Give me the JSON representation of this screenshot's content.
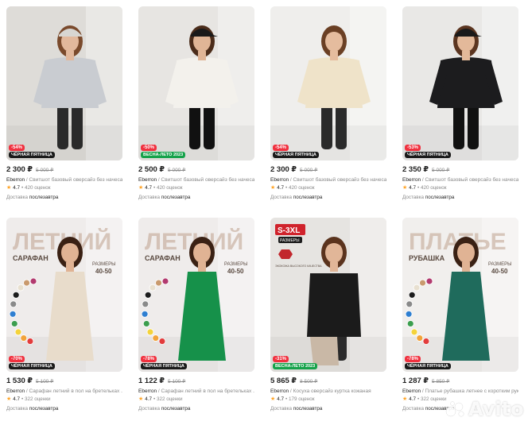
{
  "listing": {
    "products": [
      {
        "price": "2 300 ₽",
        "old_price": "5 000 ₽",
        "brand": "Eberron",
        "title": " / Свитшот базовый оверсайз без начеса ...",
        "rating": "4.7",
        "reviews": "• 420 оценок",
        "delivery_prefix": "Доставка ",
        "delivery_day": "послезавтра",
        "discount": "-54%",
        "promo": "ЧЁРНАЯ ПЯТНИЦА",
        "promo_color": "#1a1a1a",
        "photo_bg": "#dedcd8",
        "garment": "#c9ccd1",
        "skin": "#e2b89c",
        "hair": "#7a4a2c"
      },
      {
        "price": "2 500 ₽",
        "old_price": "5 000 ₽",
        "brand": "Eberron",
        "title": " / Свитшот базовый оверсайз без начеса ...",
        "rating": "4.7",
        "reviews": "• 420 оценок",
        "delivery_prefix": "Доставка ",
        "delivery_day": "послезавтра",
        "discount": "-50%",
        "promo": "ВЕСНА-ЛЕТО 2023",
        "promo_color": "#15a24a",
        "photo_bg": "#e7e5e2",
        "garment": "#f3f1ec",
        "skin": "#e0b596",
        "hair": "#4b2c1a"
      },
      {
        "price": "2 300 ₽",
        "old_price": "5 000 ₽",
        "brand": "Eberron",
        "title": " / Свитшот базовый оверсайз без начеса ...",
        "rating": "4.7",
        "reviews": "• 420 оценок",
        "delivery_prefix": "Доставка ",
        "delivery_day": "послезавтра",
        "discount": "-54%",
        "promo": "ЧЁРНАЯ ПЯТНИЦА",
        "promo_color": "#1a1a1a",
        "photo_bg": "#efeeec",
        "garment": "#efe3c9",
        "skin": "#e5bc9e",
        "hair": "#6a3f24"
      },
      {
        "price": "2 350 ₽",
        "old_price": "5 000 ₽",
        "brand": "Eberron",
        "title": " / Свитшот базовый оверсайз без начеса ...",
        "rating": "4.7",
        "reviews": "• 420 оценок",
        "delivery_prefix": "Доставка ",
        "delivery_day": "послезавтра",
        "discount": "-53%",
        "promo": "ЧЁРНАЯ ПЯТНИЦА",
        "promo_color": "#1a1a1a",
        "photo_bg": "#e9e8e6",
        "garment": "#1c1c1e",
        "skin": "#e3b99a",
        "hair": "#5b3520"
      },
      {
        "price": "1 530 ₽",
        "old_price": "5 100 ₽",
        "brand": "Eberron",
        "title": " / Сарафан летний в пол на бретельках ...",
        "rating": "4.7",
        "reviews": "• 322 оценки",
        "delivery_prefix": "Доставка ",
        "delivery_day": "послезавтра",
        "discount": "-70%",
        "promo": "ЧЁРНАЯ ПЯТНИЦА",
        "promo_color": "#1a1a1a",
        "photo_bg": "#efeceb",
        "garment": "#e8dccb",
        "skin": "#e0b394",
        "hair": "#3a2114",
        "banner": {
          "headline": "ЛЕТНИЙ",
          "sub": "САРАФАН",
          "sizes_label": "РАЗМЕРЫ",
          "sizes": "40-50"
        }
      },
      {
        "price": "1 122 ₽",
        "old_price": "5 100 ₽",
        "brand": "Eberron",
        "title": " / Сарафан летний в пол на бретельках ...",
        "rating": "4.7",
        "reviews": "• 322 оценки",
        "delivery_prefix": "Доставка ",
        "delivery_day": "послезавтра",
        "discount": "-78%",
        "promo": "ЧЁРНАЯ ПЯТНИЦА",
        "promo_color": "#1a1a1a",
        "photo_bg": "#efeceb",
        "garment": "#16914a",
        "skin": "#e0b394",
        "hair": "#3a2114",
        "banner": {
          "headline": "ЛЕТНИЙ",
          "sub": "САРАФАН",
          "sizes_label": "РАЗМЕРЫ",
          "sizes": "40-50"
        }
      },
      {
        "price": "5 865 ₽",
        "old_price": "8 500 ₽",
        "brand": "Eberron",
        "title": " / Косуха оверсайз куртка кожаная",
        "rating": "4.7",
        "reviews": "• 179 оценок",
        "delivery_prefix": "Доставка ",
        "delivery_day": "послезавтра",
        "discount": "-31%",
        "promo": "ВЕСНА-ЛЕТО 2023",
        "promo_color": "#15a24a",
        "photo_bg": "#e6e4e1",
        "garment": "#1b1b1b",
        "skin": "#e1b698",
        "hair": "#5a331d",
        "banner": {
          "size_tag": "S-3XL",
          "sizes_label": "РАЗМЕРЫ",
          "eco": "ЭКОКОЖА ВЫСОКОГО КАЧЕСТВА"
        }
      },
      {
        "price": "1 287 ₽",
        "old_price": "5 850 ₽",
        "brand": "Eberron",
        "title": " / Платье рубашка летнее с коротким рук...",
        "rating": "4.7",
        "reviews": "• 322 оценки",
        "delivery_prefix": "Доставка ",
        "delivery_day": "послезавтра",
        "discount": "-78%",
        "promo": "ЧЁРНАЯ ПЯТНИЦА",
        "promo_color": "#1a1a1a",
        "photo_bg": "#f1efed",
        "garment": "#1f6b5c",
        "skin": "#e0b394",
        "hair": "#3a2114",
        "banner": {
          "headline": "ПЛАТЬЕ",
          "sub": "РУБАШКА",
          "sizes_label": "РАЗМЕРЫ",
          "sizes": "40-50"
        }
      }
    ]
  },
  "watermark": {
    "text": "Avito"
  },
  "colors": {
    "discount": "#f0313f",
    "star": "#ffa426",
    "muted": "#8a8a8a"
  }
}
